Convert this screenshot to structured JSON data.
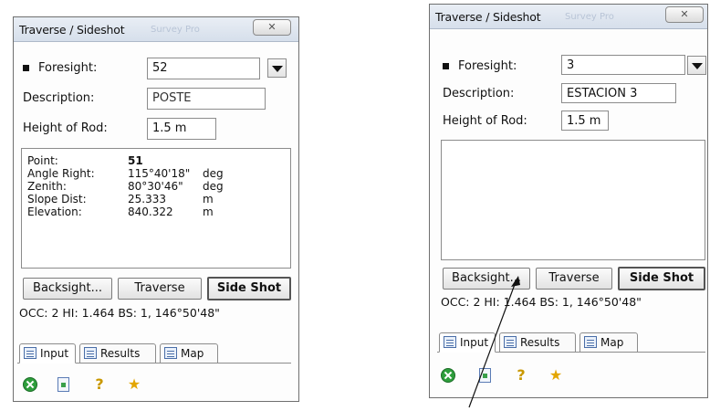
{
  "left_window": {
    "title": "Traverse / Sideshot",
    "title_ghost": "Survey Pro",
    "close_label": "✕",
    "foresight_label": "Foresight:",
    "foresight_value": "52",
    "description_label": "Description:",
    "description_value": "POSTE",
    "rod_label": "Height of Rod:",
    "rod_value": "1.5 m",
    "results": [
      {
        "label": "Point:",
        "value": "51",
        "unit": ""
      },
      {
        "label": "Angle Right:",
        "value": "115°40'18\"",
        "unit": "deg"
      },
      {
        "label": "Zenith:",
        "value": "80°30'46\"",
        "unit": "deg"
      },
      {
        "label": "Slope Dist:",
        "value": "25.333",
        "unit": "m"
      },
      {
        "label": "Elevation:",
        "value": "840.322",
        "unit": "m"
      }
    ],
    "buttons": {
      "backsight": "Backsight...",
      "traverse": "Traverse",
      "sideshot": "Side Shot"
    },
    "status": "OCC: 2  HI: 1.464  BS: 1, 146°50'48\"",
    "tabs": {
      "input": "Input",
      "results": "Results",
      "map": "Map"
    }
  },
  "right_window": {
    "title": "Traverse / Sideshot",
    "title_ghost": "Survey Pro",
    "close_label": "✕",
    "foresight_label": "Foresight:",
    "foresight_value": "3",
    "description_label": "Description:",
    "description_value": "ESTACION 3",
    "rod_label": "Height of Rod:",
    "rod_value": "1.5 m",
    "buttons": {
      "backsight": "Backsight...",
      "traverse": "Traverse",
      "sideshot": "Side Shot"
    },
    "status": "OCC: 2  HI: 1.464  BS: 1, 146°50'48\"",
    "tabs": {
      "input": "Input",
      "results": "Results",
      "map": "Map"
    }
  },
  "icons": [
    "ok-icon",
    "document-icon",
    "help-icon",
    "star-icon"
  ],
  "colors": {
    "titlebar": "#dbe3ee",
    "ok_green": "#2e9e3c",
    "star_gold": "#e3a600"
  }
}
